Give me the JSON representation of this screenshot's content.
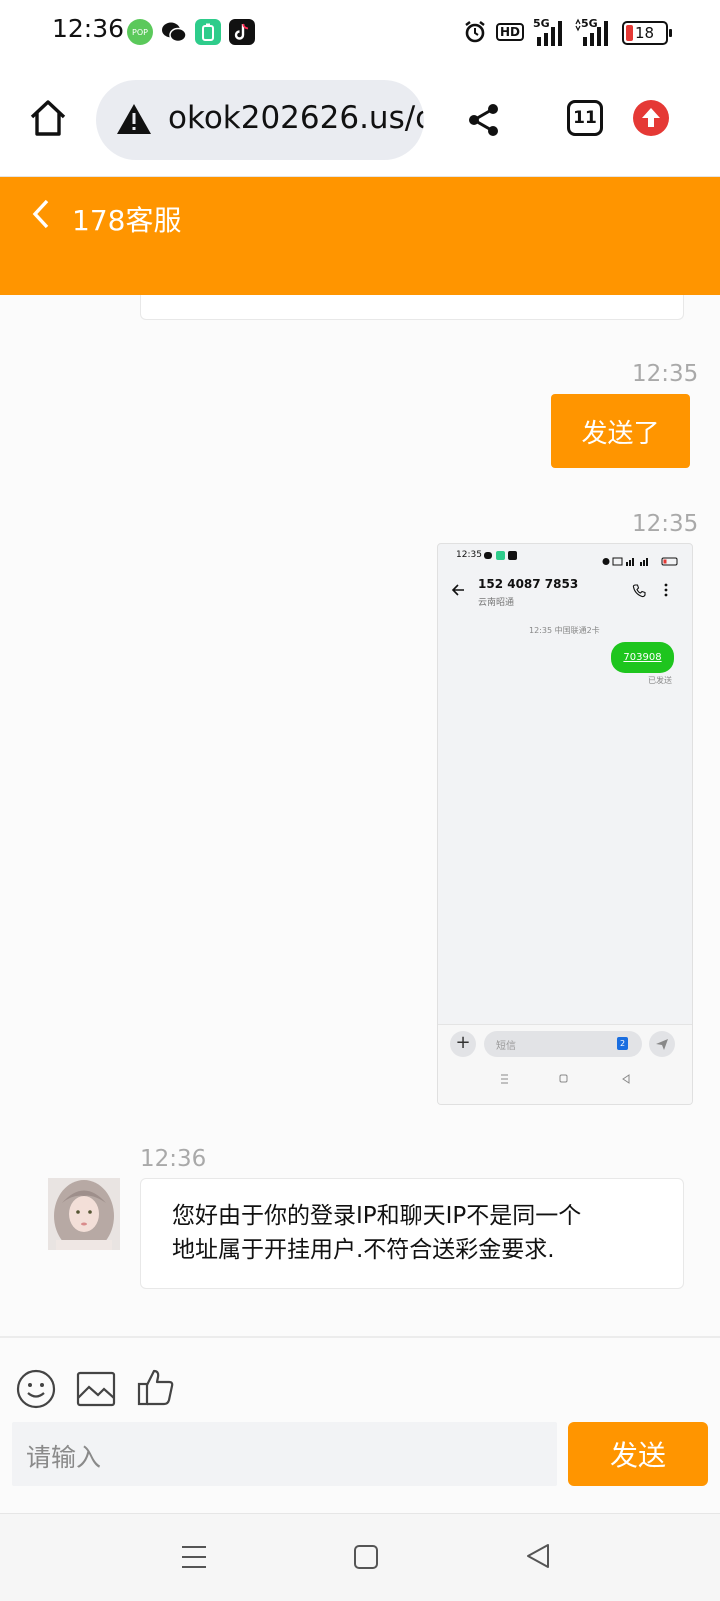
{
  "status_bar": {
    "time": "12:36",
    "notif_pop_label": "POP",
    "hd_label": "HD",
    "signal1_label": "5G",
    "signal2_label": "5G",
    "battery_level": "18"
  },
  "browser": {
    "url": "okok202626.us/c",
    "tab_count": "11"
  },
  "header": {
    "title": "178客服"
  },
  "chat": {
    "messages": [
      {
        "time": "12:35",
        "text": "发送了"
      },
      {
        "time": "12:35"
      },
      {
        "time": "12:36",
        "text_line1": "您好由于你的登录IP和聊天IP不是同一个",
        "text_line2": "地址属于开挂用户.不符合送彩金要求."
      }
    ]
  },
  "embedded_screenshot": {
    "time": "12:35",
    "phone_number": "152 4087 7853",
    "location": "云南昭通",
    "carrier_line": "12:35 中国联通2卡",
    "code": "703908",
    "sent_status": "已发送",
    "input_placeholder": "短信",
    "sim_badge": "2"
  },
  "composer": {
    "placeholder": "请输入",
    "send_label": "发送"
  },
  "colors": {
    "brand_orange": "#ff9500",
    "sms_green": "#1ec51e"
  },
  "icons": [
    "home-icon",
    "warning-icon",
    "share-icon",
    "tabs-icon",
    "update-icon",
    "back-chevron-icon",
    "emoji-icon",
    "image-icon",
    "thumbs-up-icon",
    "menu-icon",
    "home-square-icon",
    "back-triangle-icon"
  ]
}
